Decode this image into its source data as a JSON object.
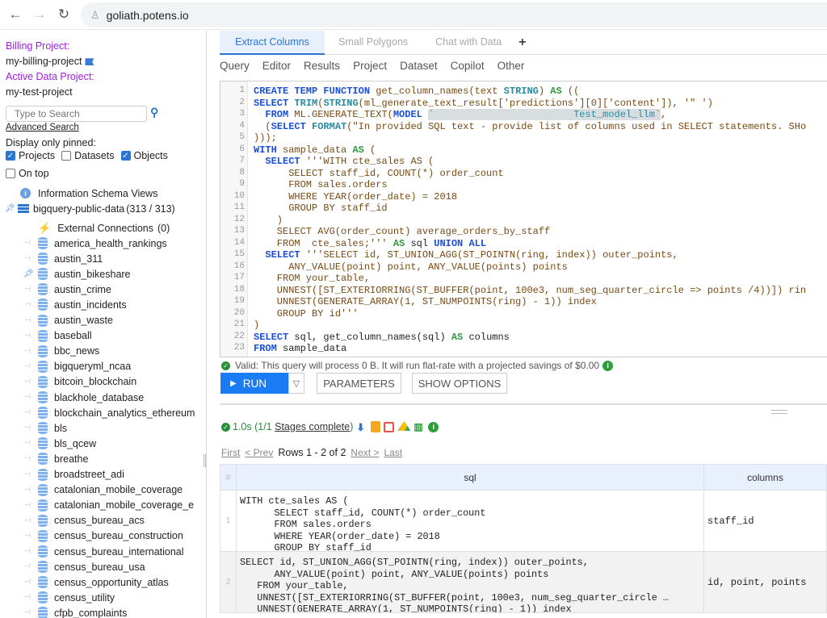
{
  "browser": {
    "url": "goliath.potens.io"
  },
  "sidebar": {
    "billing_label": "Billing Project:",
    "billing_value": "my-billing-project",
    "active_label": "Active Data Project:",
    "active_value": "my-test-project",
    "search_placeholder": "Type to Search",
    "advanced_search": "Advanced Search",
    "display_pinned": "Display only pinned:",
    "checkboxes": [
      {
        "label": "Projects",
        "checked": true
      },
      {
        "label": "Datasets",
        "checked": false
      },
      {
        "label": "Objects",
        "checked": true
      },
      {
        "label": "On top",
        "checked": false
      }
    ],
    "info_schema": "Information Schema Views",
    "project": "bigquery-public-data",
    "project_count": "(313 / 313)",
    "external": "External Connections",
    "external_count": "(0)",
    "datasets": [
      {
        "name": "america_health_rankings",
        "pinned": false
      },
      {
        "name": "austin_311",
        "pinned": false
      },
      {
        "name": "austin_bikeshare",
        "pinned": true
      },
      {
        "name": "austin_crime",
        "pinned": false
      },
      {
        "name": "austin_incidents",
        "pinned": false
      },
      {
        "name": "austin_waste",
        "pinned": false
      },
      {
        "name": "baseball",
        "pinned": false
      },
      {
        "name": "bbc_news",
        "pinned": false
      },
      {
        "name": "bigqueryml_ncaa",
        "pinned": false
      },
      {
        "name": "bitcoin_blockchain",
        "pinned": false
      },
      {
        "name": "blackhole_database",
        "pinned": false
      },
      {
        "name": "blockchain_analytics_ethereum",
        "pinned": false
      },
      {
        "name": "bls",
        "pinned": false
      },
      {
        "name": "bls_qcew",
        "pinned": false
      },
      {
        "name": "breathe",
        "pinned": false
      },
      {
        "name": "broadstreet_adi",
        "pinned": false
      },
      {
        "name": "catalonian_mobile_coverage",
        "pinned": false
      },
      {
        "name": "catalonian_mobile_coverage_e",
        "pinned": false
      },
      {
        "name": "census_bureau_acs",
        "pinned": false
      },
      {
        "name": "census_bureau_construction",
        "pinned": false
      },
      {
        "name": "census_bureau_international",
        "pinned": false
      },
      {
        "name": "census_bureau_usa",
        "pinned": false
      },
      {
        "name": "census_opportunity_atlas",
        "pinned": false
      },
      {
        "name": "census_utility",
        "pinned": false
      },
      {
        "name": "cfpb_complaints",
        "pinned": false
      }
    ]
  },
  "tabs": [
    {
      "label": "Extract Columns",
      "active": true
    },
    {
      "label": "Small Polygons",
      "active": false
    },
    {
      "label": "Chat with Data",
      "active": false
    }
  ],
  "menu": [
    "Query",
    "Editor",
    "Results",
    "Project",
    "Dataset",
    "Copilot",
    "Other"
  ],
  "editor": {
    "lines": [
      "1",
      "2",
      "3",
      "4",
      "5",
      "6",
      "7",
      "8",
      "9",
      "10",
      "11",
      "12",
      "13",
      "14",
      "15",
      "16",
      "17",
      "18",
      "19",
      "20",
      "21",
      "22",
      "23"
    ],
    "model_name": "Test_model_llm"
  },
  "validation": "Valid: This query will process 0 B. It will run flat-rate with a projected savings of $0.00",
  "buttons": {
    "run": "RUN",
    "parameters": "PARAMETERS",
    "show_options": "SHOW OPTIONS"
  },
  "status": {
    "time": "1.0s (1/1",
    "stages": "Stages complete",
    "close": ")"
  },
  "pager": {
    "first": "First",
    "prev": "< Prev",
    "rows": "Rows 1 - 2 of 2",
    "next": "Next >",
    "last": "Last"
  },
  "results": {
    "headers": [
      "#",
      "sql",
      "columns"
    ],
    "rows": [
      {
        "num": "1",
        "sql": "WITH cte_sales AS (\n      SELECT staff_id, COUNT(*) order_count\n      FROM sales.orders\n      WHERE YEAR(order_date) = 2018\n      GROUP BY staff_id",
        "columns": "staff_id"
      },
      {
        "num": "2",
        "sql": "SELECT id, ST_UNION_AGG(ST_POINTN(ring, index)) outer_points,\n      ANY_VALUE(point) point, ANY_VALUE(points) points\n   FROM your_table,\n   UNNEST([ST_EXTERIORRING(ST_BUFFER(point, 100e3, num_seg_quarter_circle …\n   UNNEST(GENERATE_ARRAY(1, ST_NUMPOINTS(ring) - 1)) index",
        "columns": "id, point, points"
      }
    ]
  }
}
